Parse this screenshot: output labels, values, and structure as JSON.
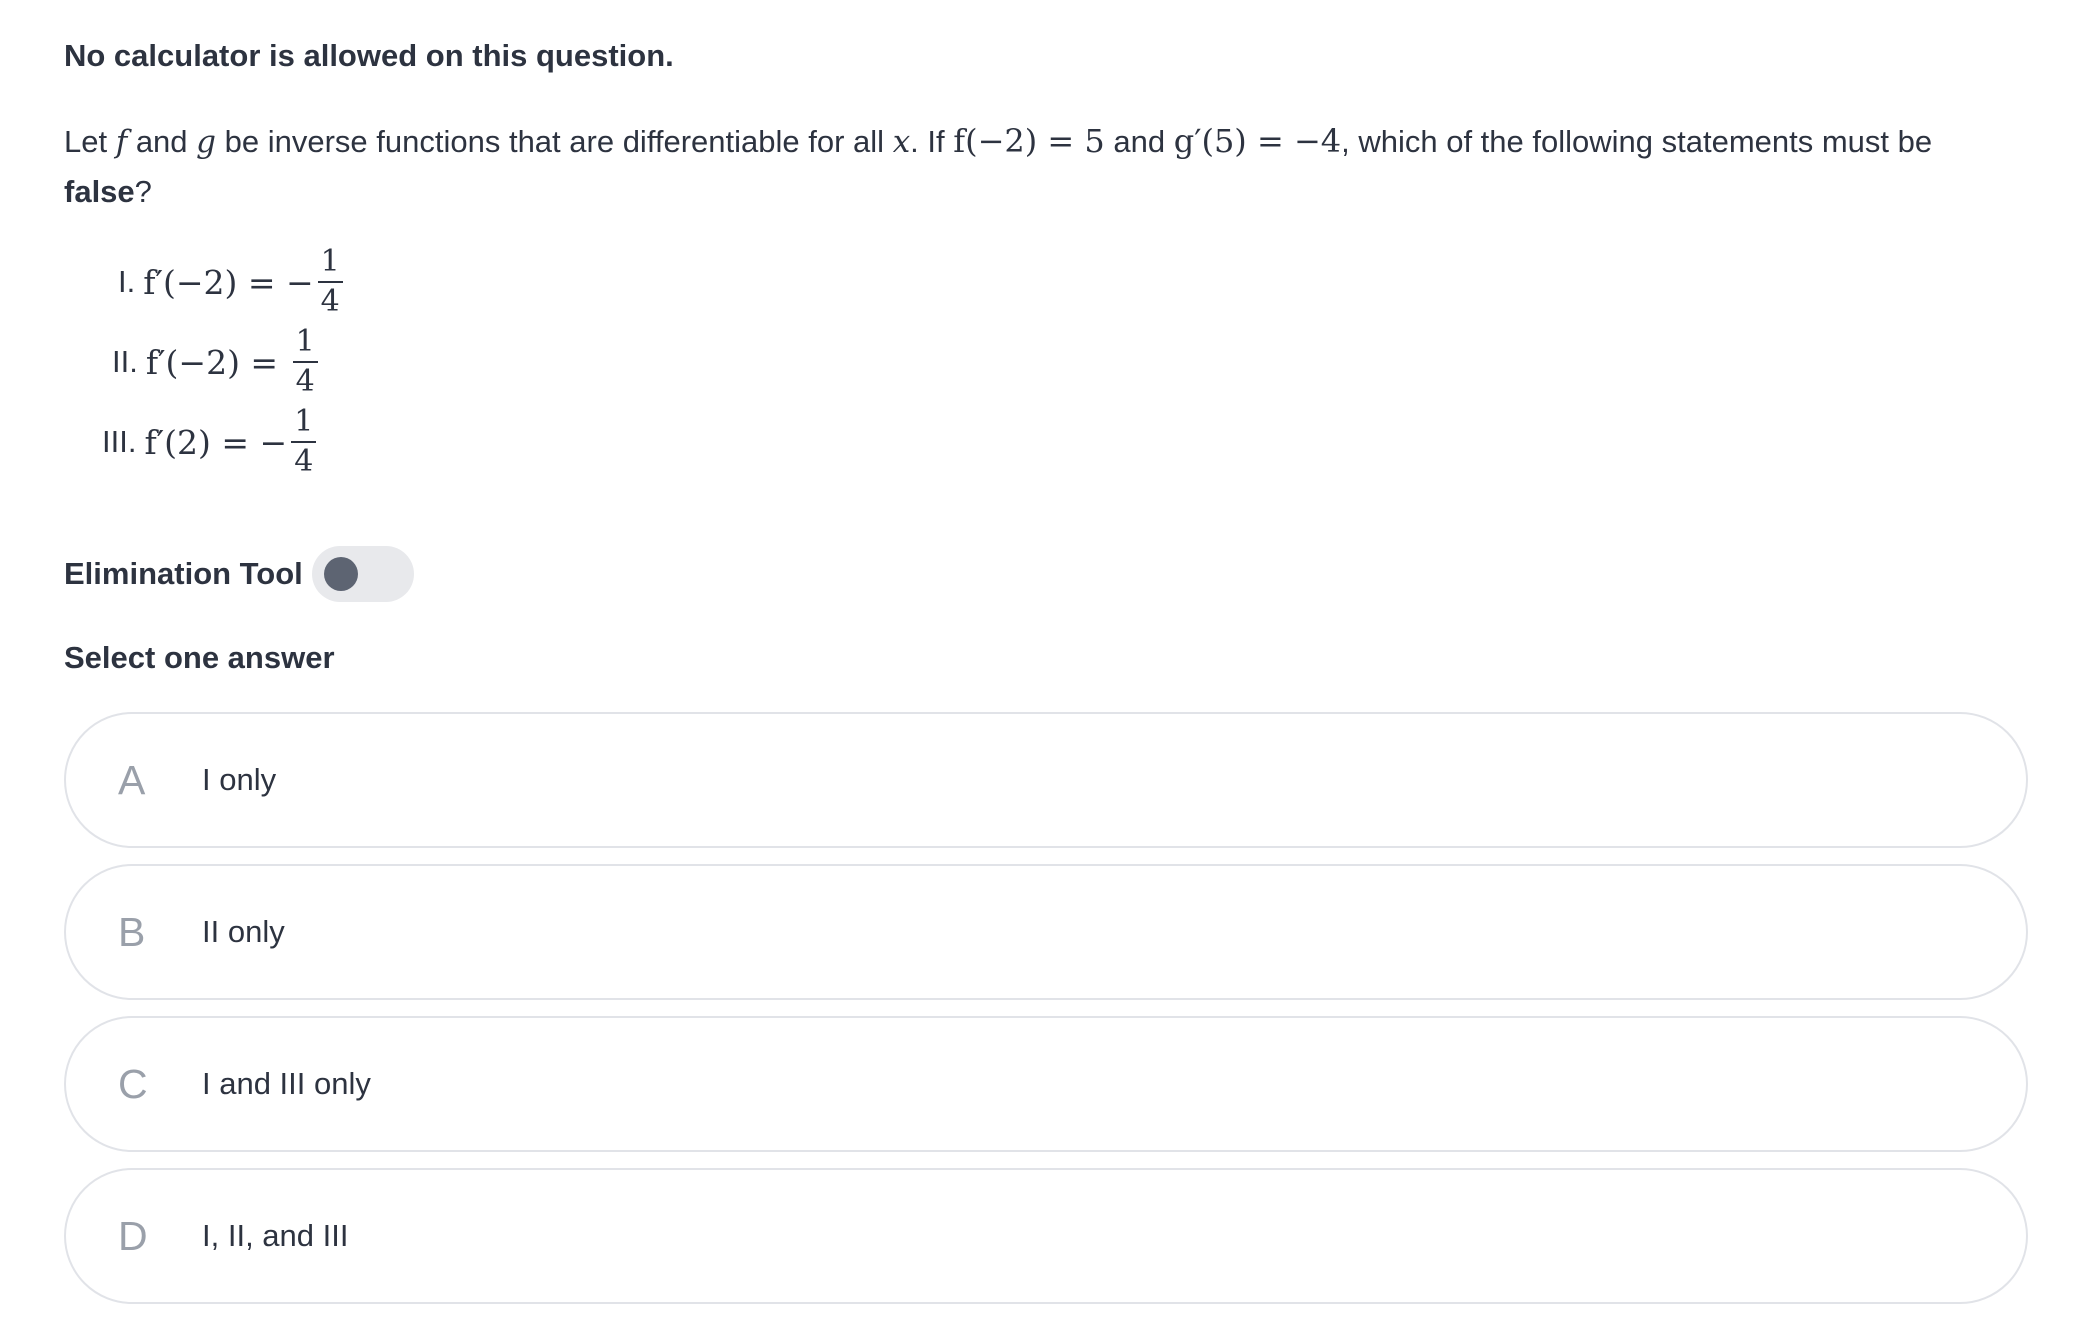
{
  "notice": "No calculator is allowed on this question.",
  "question": {
    "t1": "Let ",
    "f": "f",
    "t2": " and ",
    "g": "g",
    "t3": " be inverse functions that are differentiable for all ",
    "x": "x",
    "t4": ". If ",
    "m1": "f(−2) = 5",
    "t5": " and ",
    "m2": "g′(5) = −4",
    "t6": ", which of the following statements must be ",
    "bold": "false",
    "t7": "?"
  },
  "statements": [
    {
      "roman": "I.",
      "expr": "f′(−2) = −",
      "num": "1",
      "den": "4"
    },
    {
      "roman": "II.",
      "expr": "f′(−2) = ",
      "num": "1",
      "den": "4"
    },
    {
      "roman": "III.",
      "expr": "f′(2) = −",
      "num": "1",
      "den": "4"
    }
  ],
  "elimination_tool": {
    "label": "Elimination Tool",
    "on": false
  },
  "select_label": "Select one answer",
  "options": [
    {
      "letter": "A",
      "text": "I only"
    },
    {
      "letter": "B",
      "text": "II only"
    },
    {
      "letter": "C",
      "text": "I and III only"
    },
    {
      "letter": "D",
      "text": "I, II, and III"
    }
  ],
  "colors": {
    "text": "#2d3340",
    "letter": "#9aa0aa",
    "border": "#e1e3e8",
    "toggle_track": "#e8e9ec",
    "toggle_knob": "#5d6472"
  }
}
